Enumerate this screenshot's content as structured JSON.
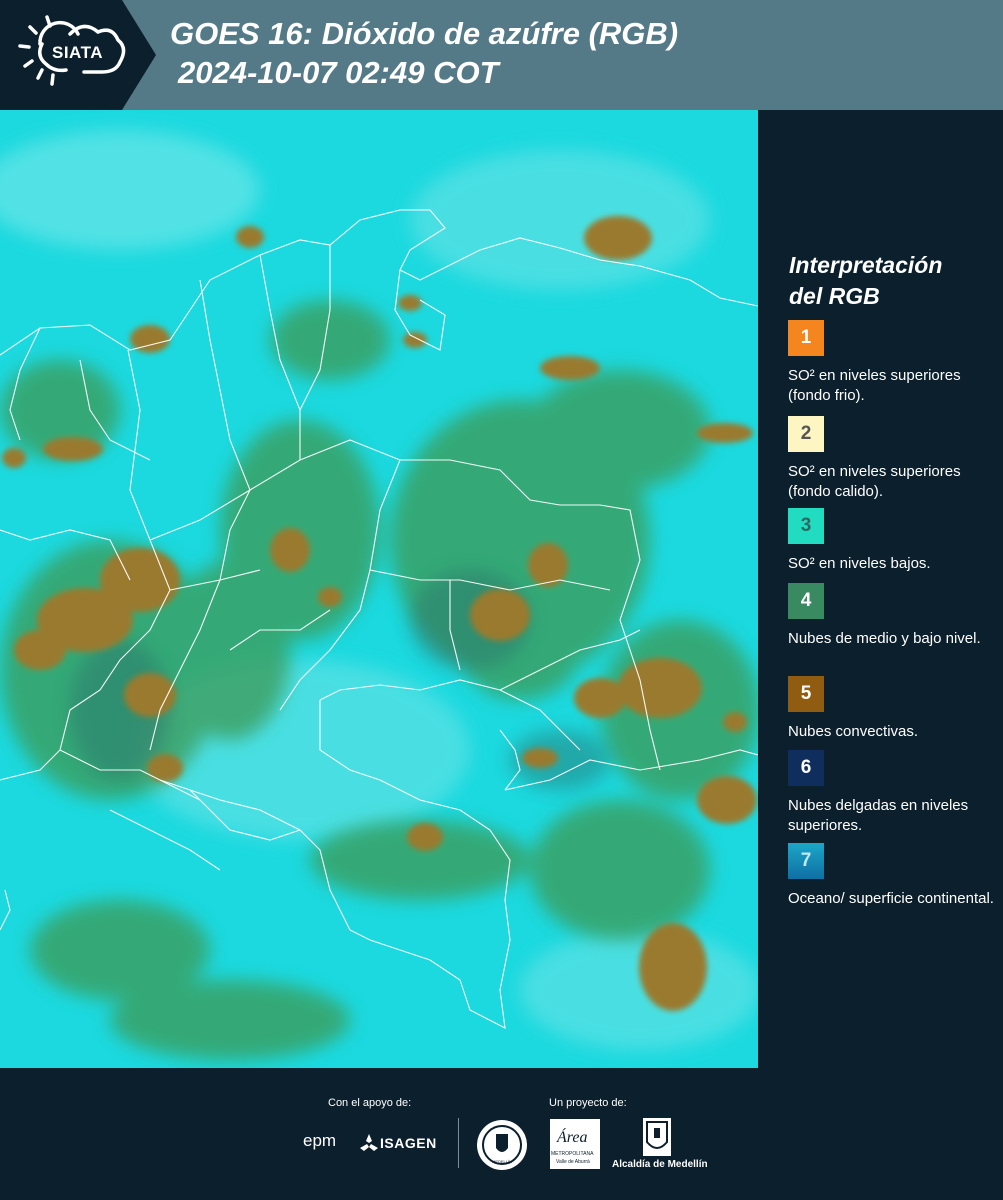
{
  "header": {
    "brand": "SIATA",
    "title_line1": "GOES 16: Dióxido de azúfre (RGB)",
    "title_line2": "2024-10-07 02:49 COT"
  },
  "map": {
    "background_color": "#1bd9df",
    "cloud_colors": {
      "convective": "#9a7a2e",
      "mid_low": "#3e9a55",
      "border": "#ffffff"
    }
  },
  "legend": {
    "title_line1": "Interpretación",
    "title_line2": "del RGB",
    "items": [
      {
        "number": "1",
        "color": "#f5861f",
        "label": "SO² en niveles superiores (fondo frio)."
      },
      {
        "number": "2",
        "color": "#fdf6c3",
        "label": "SO² en niveles superiores (fondo calido)."
      },
      {
        "number": "3",
        "color": "#21dcc0",
        "label": "SO² en niveles bajos."
      },
      {
        "number": "4",
        "color": "#3a8a61",
        "label": "Nubes de medio y bajo nivel."
      },
      {
        "number": "5",
        "color": "#8f5c12",
        "label": "Nubes convectivas."
      },
      {
        "number": "6",
        "color": "#0f2e5e",
        "label": "Nubes delgadas en niveles superiores."
      },
      {
        "number": "7",
        "color": "#1582b4",
        "label": "Oceano/ superficie continental."
      }
    ]
  },
  "footer": {
    "support_label": "Con el apoyo de:",
    "project_label": "Un proyecto de:",
    "epm": "epm",
    "isagen": "ISAGEN",
    "medellin_seal": "MEDELLÍN",
    "area": "Área",
    "area_sub1": "METROPOLITANA",
    "area_sub2": "Valle de Aburrá",
    "alcaldia": "Alcaldía de Medellín"
  }
}
